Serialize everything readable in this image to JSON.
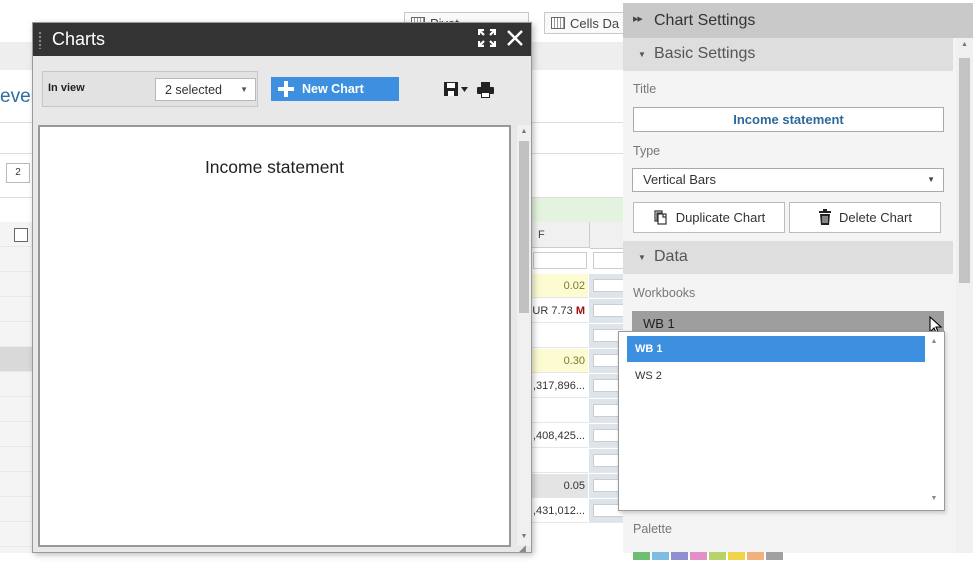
{
  "background": {
    "pivot_label": "Pivot",
    "cells_label": "Cells Da",
    "title_fragment": "even",
    "num_cell": "2",
    "col_header": "F",
    "rows": [
      {
        "text": "0.02",
        "style": "yellow"
      },
      {
        "text": "UR 7.73 ",
        "marker": "M",
        "style": "plain"
      },
      {
        "text": "",
        "style": "plain"
      },
      {
        "text": "0.30",
        "style": "yellow"
      },
      {
        "text": ",317,896...",
        "style": "plain"
      },
      {
        "text": "",
        "style": "plain"
      },
      {
        "text": ",408,425...",
        "style": "plain"
      },
      {
        "text": "",
        "style": "plain"
      },
      {
        "text": "0.05",
        "style": "grey"
      },
      {
        "text": ",431,012...",
        "style": "plain"
      }
    ]
  },
  "charts_panel": {
    "title": "Charts",
    "in_view_label": "In view",
    "in_view_value": "2 selected",
    "new_chart_label": "New Chart",
    "chart_title": "Income statement"
  },
  "settings": {
    "header": "Chart Settings",
    "basic_section": "Basic Settings",
    "title_label": "Title",
    "title_value": "Income statement",
    "type_label": "Type",
    "type_value": "Vertical Bars",
    "duplicate_label": "Duplicate Chart",
    "delete_label": "Delete Chart",
    "data_section": "Data",
    "workbooks_label": "Workbooks",
    "workbook_value": "WB 1",
    "workbook_options": [
      "WB 1",
      "WS 2"
    ],
    "palette_label": "Palette",
    "palette_colors": [
      "#6fbf73",
      "#7fbde0",
      "#8f8fd0",
      "#e58fc9",
      "#b9d36b",
      "#f2d44a",
      "#f0b27a",
      "#a0a0a0"
    ]
  },
  "colors": {
    "accent": "#3d8fe0",
    "header_dark": "#333333",
    "title_blue": "#2d6a9b"
  }
}
